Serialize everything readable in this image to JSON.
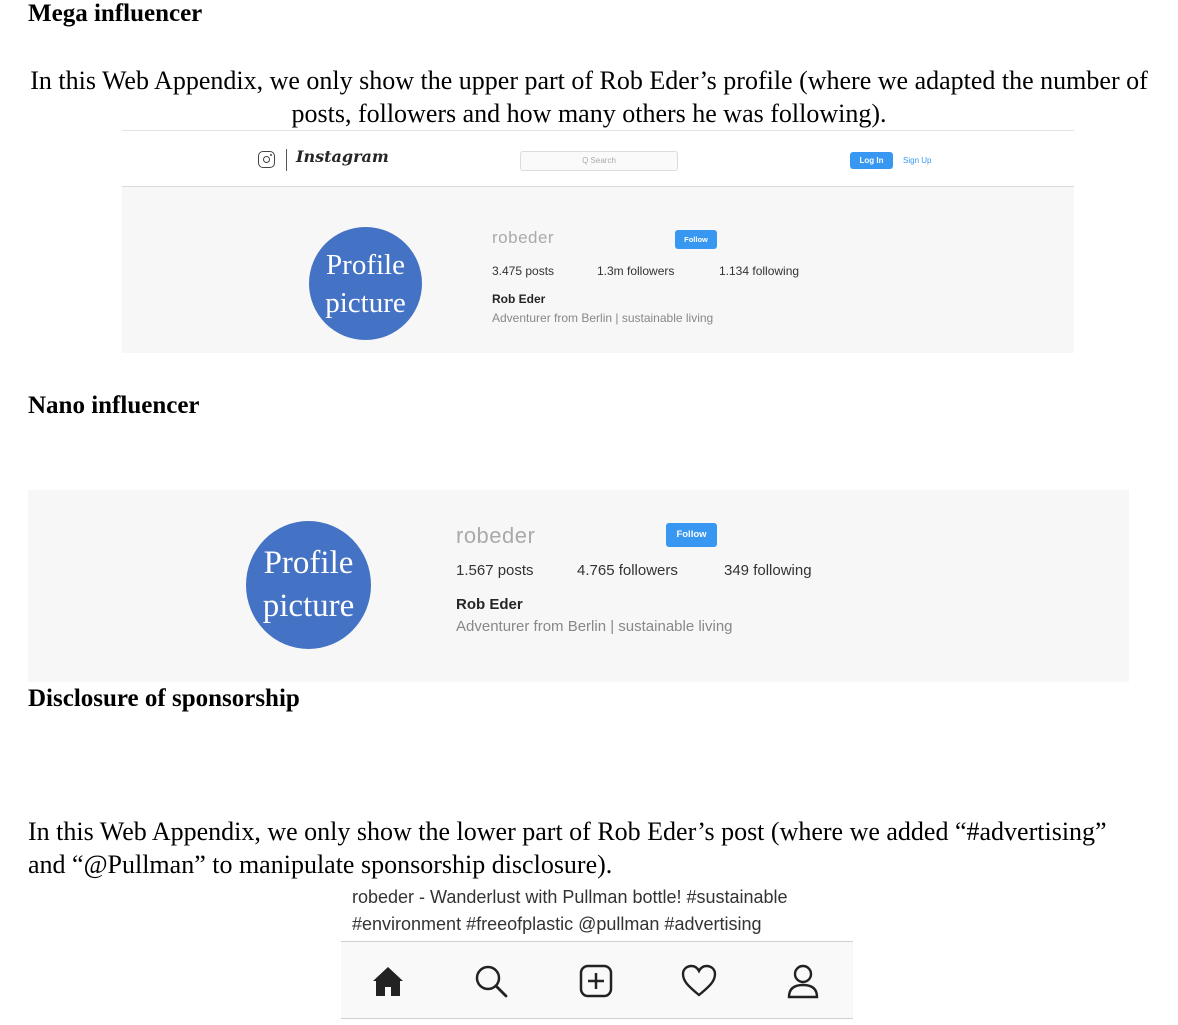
{
  "sections": {
    "mega_heading": "Mega influencer",
    "mega_text": "In this Web Appendix, we only show the upper part of Rob Eder’s profile (where we adapted the number of posts, followers and how many others he was following).",
    "nano_heading": "Nano influencer",
    "disclosure_heading": "Disclosure of sponsorship",
    "disclosure_text": "In this Web Appendix, we only show the lower part of Rob Eder’s post (where we added “#advertising” and “@Pullman” to manipulate sponsorship disclosure)."
  },
  "mega_profile": {
    "navbar": {
      "logo_text": "Instagram",
      "search_placeholder": "Q Search",
      "login_label": "Log In",
      "signup_label": "Sign Up"
    },
    "avatar_line1": "Profile",
    "avatar_line2": "picture",
    "username": "robeder",
    "follow_label": "Follow",
    "posts": "3.475 posts",
    "followers": "1.3m followers",
    "following": "1.134 following",
    "full_name": "Rob Eder",
    "bio": "Adventurer from Berlin | sustainable living"
  },
  "nano_profile": {
    "avatar_line1": "Profile",
    "avatar_line2": "picture",
    "username": "robeder",
    "follow_label": "Follow",
    "posts": "1.567 posts",
    "followers": "4.765 followers",
    "following": "349 following",
    "full_name": "Rob Eder",
    "bio": "Adventurer from Berlin | sustainable living"
  },
  "post": {
    "caption_line1": "robeder - Wanderlust with Pullman bottle! #sustainable",
    "caption_line2": "#environment #freeofplastic @pullman #advertising",
    "icons": [
      "home-icon",
      "search-icon",
      "add-post-icon",
      "heart-icon",
      "profile-icon"
    ]
  },
  "colors": {
    "instagram_blue": "#3897f0",
    "avatar_blue": "#4472c4"
  }
}
